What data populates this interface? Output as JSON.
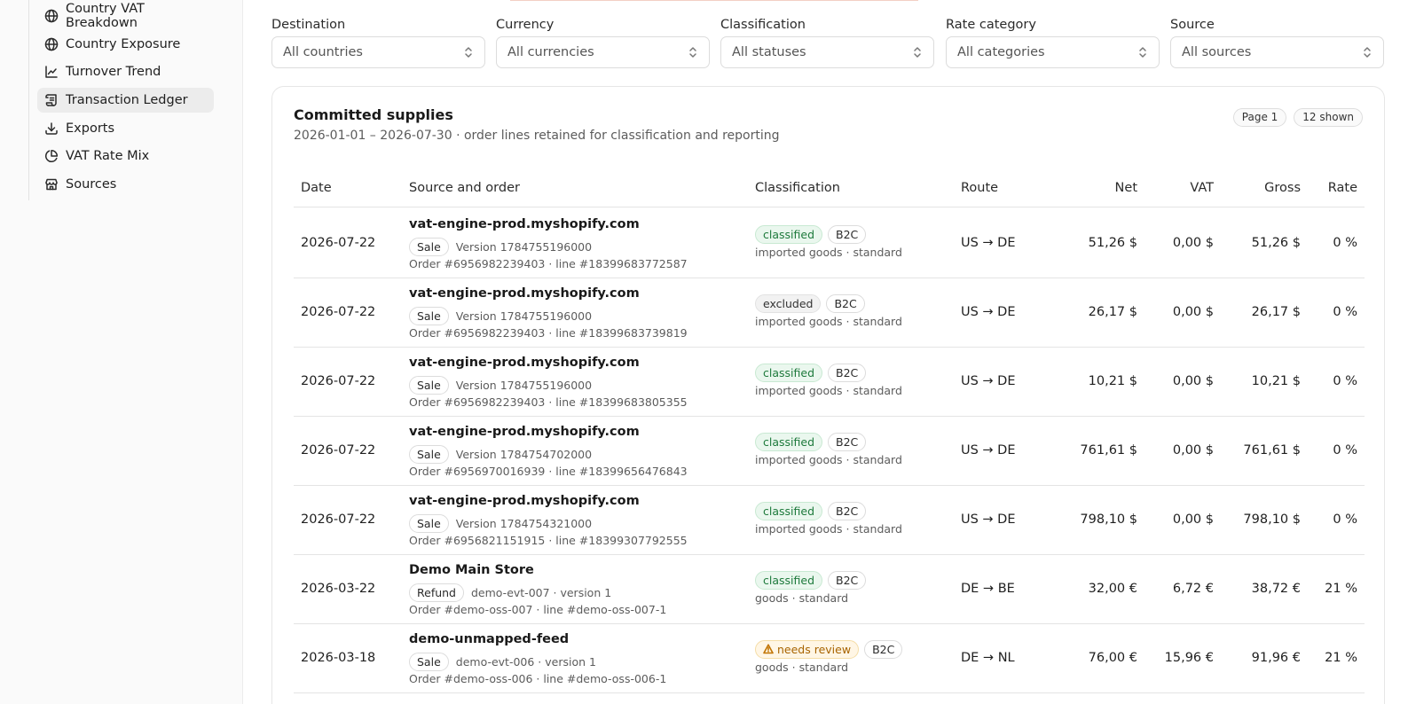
{
  "sidebar": {
    "items": [
      {
        "label": "Country VAT Breakdown",
        "icon": "globe-icon",
        "active": false
      },
      {
        "label": "Country Exposure",
        "icon": "globe-icon",
        "active": false
      },
      {
        "label": "Turnover Trend",
        "icon": "line-chart-icon",
        "active": false
      },
      {
        "label": "Transaction Ledger",
        "icon": "ledger-icon",
        "active": true
      },
      {
        "label": "Exports",
        "icon": "download-icon",
        "active": false
      },
      {
        "label": "VAT Rate Mix",
        "icon": "pie-chart-icon",
        "active": false
      },
      {
        "label": "Sources",
        "icon": "store-icon",
        "active": false
      }
    ]
  },
  "filters": [
    {
      "label": "Destination",
      "value": "All countries"
    },
    {
      "label": "Currency",
      "value": "All currencies"
    },
    {
      "label": "Classification",
      "value": "All statuses"
    },
    {
      "label": "Rate category",
      "value": "All categories"
    },
    {
      "label": "Source",
      "value": "All sources"
    }
  ],
  "card": {
    "title": "Committed supplies",
    "subtitle": "2026-01-01 – 2026-07-30 · order lines retained for classification and reporting",
    "page_label": "Page 1",
    "shown_label": "12 shown"
  },
  "table": {
    "headers": {
      "date": "Date",
      "source": "Source and order",
      "classification": "Classification",
      "route": "Route",
      "net": "Net",
      "vat": "VAT",
      "gross": "Gross",
      "rate": "Rate"
    },
    "rows": [
      {
        "date": "2026-07-22",
        "source": "vat-engine-prod.myshopify.com",
        "type": "Sale",
        "version": "Version 1784755196000",
        "order": "Order #6956982239403 · line #18399683772587",
        "status": "classified",
        "status_kind": "classified",
        "channel": "B2C",
        "detail": "imported goods · standard",
        "route": "US → DE",
        "net": "51,26 $",
        "vat": "0,00 $",
        "gross": "51,26 $",
        "rate": "0 %"
      },
      {
        "date": "2026-07-22",
        "source": "vat-engine-prod.myshopify.com",
        "type": "Sale",
        "version": "Version 1784755196000",
        "order": "Order #6956982239403 · line #18399683739819",
        "status": "excluded",
        "status_kind": "excluded",
        "channel": "B2C",
        "detail": "imported goods · standard",
        "route": "US → DE",
        "net": "26,17 $",
        "vat": "0,00 $",
        "gross": "26,17 $",
        "rate": "0 %"
      },
      {
        "date": "2026-07-22",
        "source": "vat-engine-prod.myshopify.com",
        "type": "Sale",
        "version": "Version 1784755196000",
        "order": "Order #6956982239403 · line #18399683805355",
        "status": "classified",
        "status_kind": "classified",
        "channel": "B2C",
        "detail": "imported goods · standard",
        "route": "US → DE",
        "net": "10,21 $",
        "vat": "0,00 $",
        "gross": "10,21 $",
        "rate": "0 %"
      },
      {
        "date": "2026-07-22",
        "source": "vat-engine-prod.myshopify.com",
        "type": "Sale",
        "version": "Version 1784754702000",
        "order": "Order #6956970016939 · line #18399656476843",
        "status": "classified",
        "status_kind": "classified",
        "channel": "B2C",
        "detail": "imported goods · standard",
        "route": "US → DE",
        "net": "761,61 $",
        "vat": "0,00 $",
        "gross": "761,61 $",
        "rate": "0 %"
      },
      {
        "date": "2026-07-22",
        "source": "vat-engine-prod.myshopify.com",
        "type": "Sale",
        "version": "Version 1784754321000",
        "order": "Order #6956821151915 · line #18399307792555",
        "status": "classified",
        "status_kind": "classified",
        "channel": "B2C",
        "detail": "imported goods · standard",
        "route": "US → DE",
        "net": "798,10 $",
        "vat": "0,00 $",
        "gross": "798,10 $",
        "rate": "0 %"
      },
      {
        "date": "2026-03-22",
        "source": "Demo Main Store",
        "type": "Refund",
        "version": "demo-evt-007 · version 1",
        "order": "Order #demo-oss-007 · line #demo-oss-007-1",
        "status": "classified",
        "status_kind": "classified",
        "channel": "B2C",
        "detail": "goods · standard",
        "route": "DE → BE",
        "net": "32,00 €",
        "vat": "6,72 €",
        "gross": "38,72 €",
        "rate": "21 %"
      },
      {
        "date": "2026-03-18",
        "source": "demo-unmapped-feed",
        "type": "Sale",
        "version": "demo-evt-006 · version 1",
        "order": "Order #demo-oss-006 · line #demo-oss-006-1",
        "status": "needs review",
        "status_kind": "review",
        "channel": "B2C",
        "detail": "goods · standard",
        "route": "DE → NL",
        "net": "76,00 €",
        "vat": "15,96 €",
        "gross": "91,96 €",
        "rate": "21 %"
      }
    ]
  }
}
